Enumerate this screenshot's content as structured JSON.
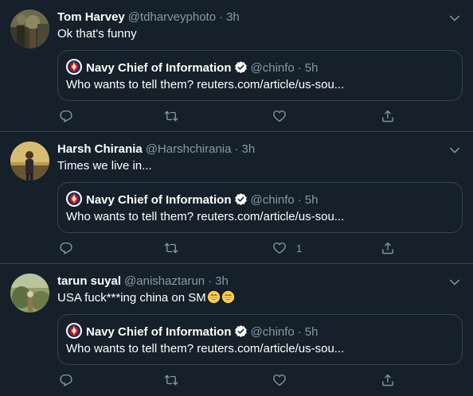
{
  "colors": {
    "background": "#15202b",
    "border": "#38444d",
    "secondary_text": "#8899a6",
    "primary_text": "#ffffff",
    "verified": "#ffffff"
  },
  "tweets": [
    {
      "name": "Tom Harvey",
      "handle": "@tdharveyphoto",
      "separator": "·",
      "time": "3h",
      "text": "Ok that's funny",
      "emojis": [],
      "quote": {
        "name": "Navy Chief of Information",
        "handle": "@chinfo",
        "separator": "·",
        "time": "5h",
        "text": "Who wants to tell them? reuters.com/article/us-sou..."
      },
      "likes": ""
    },
    {
      "name": "Harsh Chirania",
      "handle": "@Harshchirania",
      "separator": "·",
      "time": "3h",
      "text": "Times we live in...",
      "emojis": [],
      "quote": {
        "name": "Navy Chief of Information",
        "handle": "@chinfo",
        "separator": "·",
        "time": "5h",
        "text": "Who wants to tell them? reuters.com/article/us-sou..."
      },
      "likes": "1"
    },
    {
      "name": "tarun suyal",
      "handle": "@anishaztarun",
      "separator": "·",
      "time": "3h",
      "text": "USA fuck***ing china on SM",
      "emojis": [
        "grinning-face-with-smiling-eyes",
        "grinning-face-with-smiling-eyes"
      ],
      "quote": {
        "name": "Navy Chief of Information",
        "handle": "@chinfo",
        "separator": "·",
        "time": "5h",
        "text": "Who wants to tell them? reuters.com/article/us-sou..."
      },
      "likes": ""
    }
  ]
}
